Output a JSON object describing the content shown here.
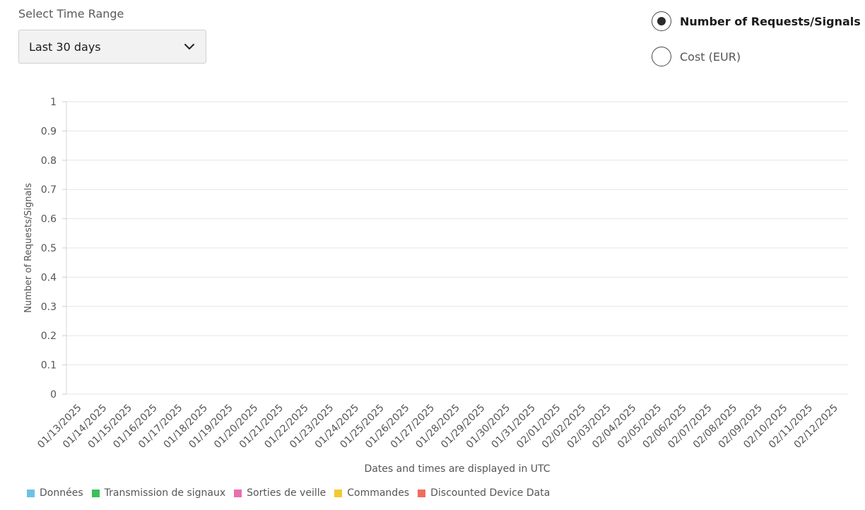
{
  "controls": {
    "range_label": "Select Time Range",
    "range_value": "Last 30 days",
    "metric_options": [
      {
        "label": "Number of Requests/Signals",
        "selected": true
      },
      {
        "label": "Cost (EUR)",
        "selected": false
      }
    ]
  },
  "chart_data": {
    "type": "bar",
    "ylabel": "Number of Requests/Signals",
    "ylim": [
      0,
      1
    ],
    "yticks": [
      "0",
      "0.1",
      "0.2",
      "0.3",
      "0.4",
      "0.5",
      "0.6",
      "0.7",
      "0.8",
      "0.9",
      "1"
    ],
    "categories": [
      "01/13/2025",
      "01/14/2025",
      "01/15/2025",
      "01/16/2025",
      "01/17/2025",
      "01/18/2025",
      "01/19/2025",
      "01/20/2025",
      "01/21/2025",
      "01/22/2025",
      "01/23/2025",
      "01/24/2025",
      "01/25/2025",
      "01/26/2025",
      "01/27/2025",
      "01/28/2025",
      "01/29/2025",
      "01/30/2025",
      "01/31/2025",
      "02/01/2025",
      "02/02/2025",
      "02/03/2025",
      "02/04/2025",
      "02/05/2025",
      "02/06/2025",
      "02/07/2025",
      "02/08/2025",
      "02/09/2025",
      "02/10/2025",
      "02/11/2025",
      "02/12/2025"
    ],
    "series": [
      {
        "name": "Données",
        "color": "#6ec1e4",
        "values": []
      },
      {
        "name": "Transmission de signaux",
        "color": "#3dbf5a",
        "values": []
      },
      {
        "name": "Sorties de veille",
        "color": "#e86fb0",
        "values": []
      },
      {
        "name": "Commandes",
        "color": "#f2c933",
        "values": []
      },
      {
        "name": "Discounted Device Data",
        "color": "#ee6e5e",
        "values": []
      }
    ],
    "grid": true,
    "legend": "bottom-left"
  },
  "footer": {
    "utc_note": "Dates and times are displayed in UTC"
  }
}
